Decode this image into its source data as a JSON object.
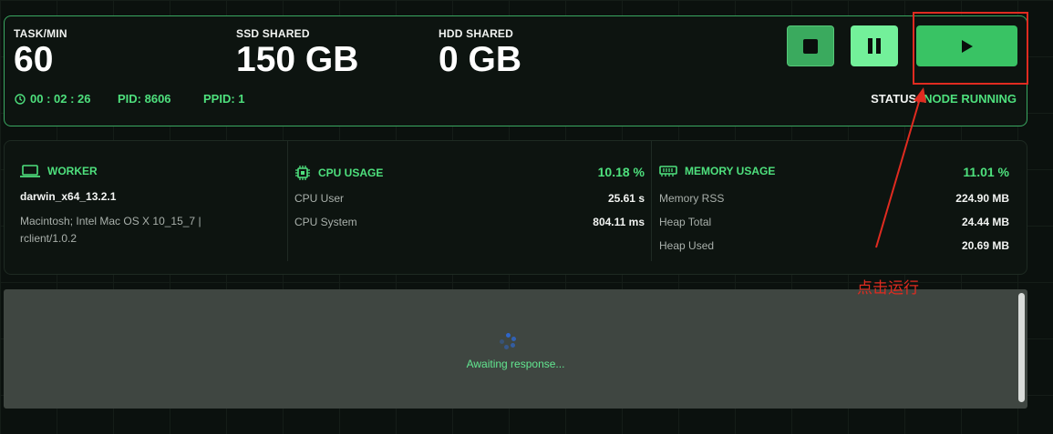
{
  "stats": [
    {
      "label": "TASK/MIN",
      "value": "60"
    },
    {
      "label": "SSD SHARED",
      "value": "150 GB"
    },
    {
      "label": "HDD SHARED",
      "value": "0 GB"
    }
  ],
  "meta": {
    "uptime": "00 : 02 : 26",
    "pid": "PID: 8606",
    "ppid": "PPID: 1"
  },
  "status": {
    "label": "STATUS:",
    "value": "NODE RUNNING"
  },
  "controls": {
    "stop_icon": "stop-icon",
    "pause_icon": "pause-icon",
    "run_icon": "play-icon",
    "accent": "#39c364"
  },
  "worker": {
    "title": "WORKER",
    "name": "darwin_x64_13.2.1",
    "ua": "Macintosh; Intel Mac OS X 10_15_7 | rclient/1.0.2",
    "icon": "laptop-icon"
  },
  "cpu": {
    "title": "CPU USAGE",
    "percent": "10.18 %",
    "icon": "cpu-icon",
    "rows": [
      {
        "label": "CPU User",
        "value": "25.61 s"
      },
      {
        "label": "CPU System",
        "value": "804.11 ms"
      }
    ]
  },
  "memory": {
    "title": "MEMORY USAGE",
    "percent": "11.01 %",
    "icon": "memory-icon",
    "rows": [
      {
        "label": "Memory RSS",
        "value": "224.90 MB"
      },
      {
        "label": "Heap Total",
        "value": "24.44 MB"
      },
      {
        "label": "Heap Used",
        "value": "20.69 MB"
      }
    ]
  },
  "console": {
    "status_text": "Awaiting response..."
  },
  "annotation": {
    "text": "点击运行",
    "color": "#e02b20"
  }
}
